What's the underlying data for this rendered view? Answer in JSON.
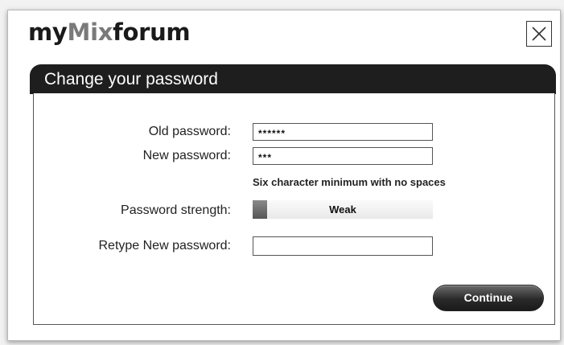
{
  "logo": {
    "part1": "my",
    "part2": "Mix",
    "part3": "forum"
  },
  "header": {
    "title": "Change your password"
  },
  "form": {
    "old_password": {
      "label": "Old password:",
      "value": "******"
    },
    "new_password": {
      "label": "New password:",
      "value": "***"
    },
    "hint": "Six character minimum with no spaces",
    "strength": {
      "label": "Password strength:",
      "value": "Weak",
      "level": 0.08
    },
    "retype_password": {
      "label": "Retype New password:",
      "value": ""
    }
  },
  "continue_label": "Continue",
  "icons": {
    "close": "close-icon"
  },
  "colors": {
    "header_bg": "#1e1e1e",
    "logo_accent": "#7a7a7a",
    "button_bg": "#2a2a2a"
  }
}
